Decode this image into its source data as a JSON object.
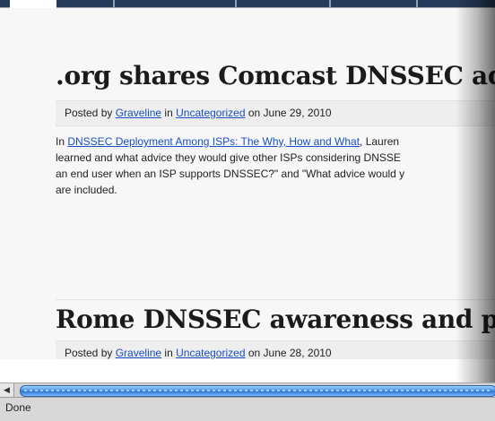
{
  "posts": [
    {
      "title": ".org shares Comcast DNSSEC advice",
      "posted_by": "Posted by",
      "author": "Graveline",
      "in": "in",
      "category": "Uncategorized",
      "on": "on June 29, 2010"
    },
    {
      "title": "Rome DNSSEC awareness and plann",
      "posted_by": "Posted by",
      "author": "Graveline",
      "in": "in",
      "category": "Uncategorized",
      "on": "on June 28, 2010"
    }
  ],
  "excerpt": {
    "prefix": "In ",
    "link": "DNSSEC Deployment Among ISPs: The Why, How and What",
    "line1_suffix": ", Lauren",
    "line2": "learned and what advice they would give other ISPs considering DNSSE",
    "line3": "an end user when an ISP supports DNSSEC?\" and \"What advice would y",
    "line4": "are included."
  },
  "status": {
    "text": "Done"
  },
  "scrollbar": {
    "left_arrow_icon": "arrow-left-icon"
  }
}
